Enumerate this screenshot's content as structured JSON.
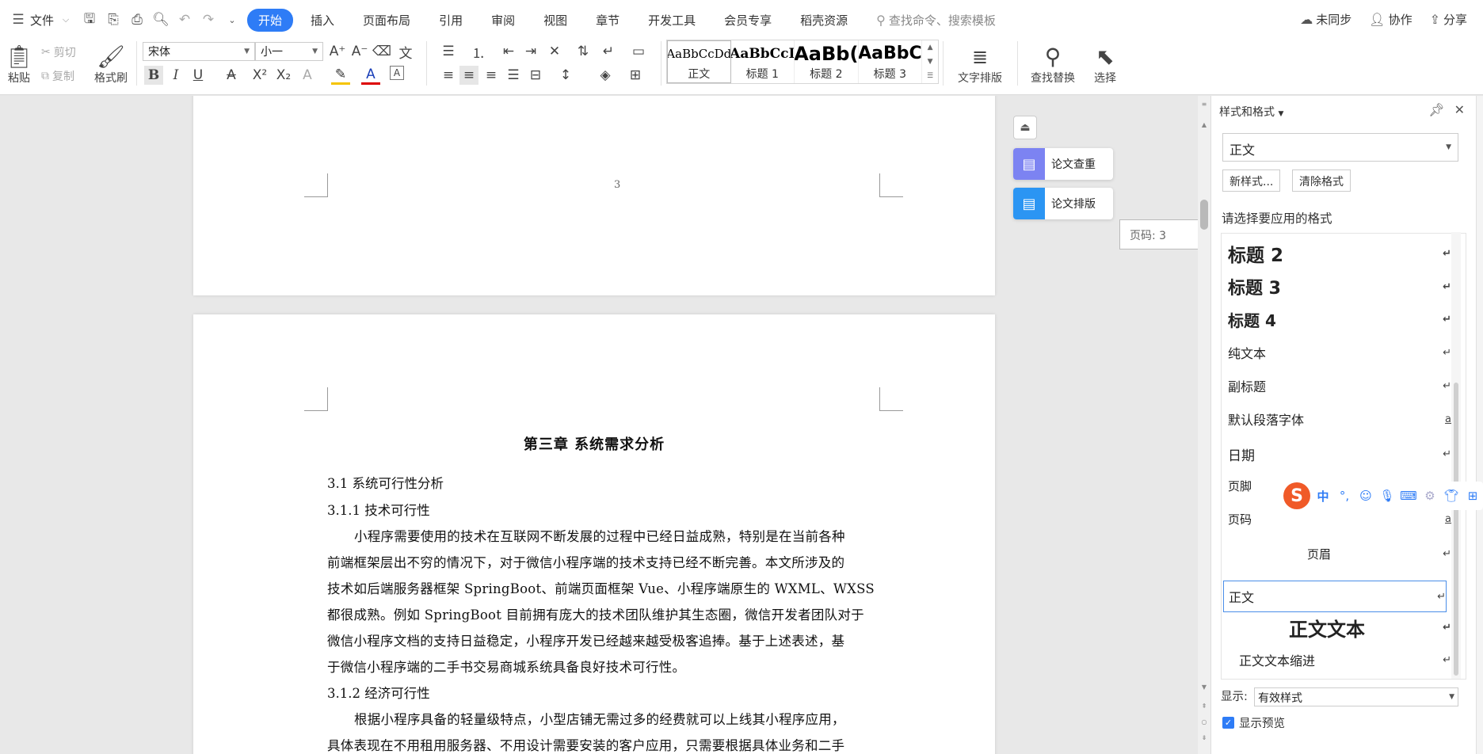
{
  "topbar": {
    "menu_label": "文件",
    "tabs": [
      "开始",
      "插入",
      "页面布局",
      "引用",
      "审阅",
      "视图",
      "章节",
      "开发工具",
      "会员专享",
      "稻壳资源"
    ],
    "active_tab_index": 0,
    "search_placeholder": "查找命令、搜索模板",
    "actions": {
      "sync": "未同步",
      "collab": "协作",
      "share": "分享"
    }
  },
  "ribbon": {
    "paste": "粘贴",
    "cut": "剪切",
    "copy": "复制",
    "format_painter": "格式刷",
    "font_name": "宋体",
    "font_size": "小一",
    "styles": [
      {
        "preview": "AaBbCcDd",
        "label": "正文"
      },
      {
        "preview": "AaBbCcI",
        "label": "标题 1"
      },
      {
        "preview": "AaBb(",
        "label": "标题 2"
      },
      {
        "preview": "AaBbC",
        "label": "标题 3"
      }
    ],
    "text_layout": "文字排版",
    "find_replace": "查找替换",
    "select": "选择"
  },
  "document": {
    "page_number": "3",
    "chapter_title": "第三章  系统需求分析",
    "heading_1": "3.1 系统可行性分析",
    "heading_2": "3.1.1  技术可行性",
    "paragraph_lines": [
      "小程序需要使用的技术在互联网不断发展的过程中已经日益成熟，特别是在当前各种",
      "前端框架层出不穷的情况下，对于微信小程序端的技术支持已经不断完善。本文所涉及的",
      "技术如后端服务器框架 SpringBoot、前端页面框架 Vue、小程序端原生的 WXML、WXSS",
      "都很成熟。例如 SpringBoot 目前拥有庞大的技术团队维护其生态圈，微信开发者团队对于",
      "微信小程序文档的支持日益稳定，小程序开发已经越来越受极客追捧。基于上述表述，基",
      "于微信小程序端的二手书交易商城系统具备良好技术可行性。"
    ],
    "heading_3": "3.1.2  经济可行性",
    "paragraph2_line": "根据小程序具备的轻量级特点，小型店铺无需过多的经费就可以上线其小程序应用，",
    "paragraph2_line2": "具体表现在不用租用服务器、不用设计需要安装的客户应用，只需要根据具体业务和二手"
  },
  "float_tools": {
    "check": "论文查重",
    "layout": "论文排版",
    "tooltip": "页码: 3"
  },
  "style_panel": {
    "title": "样式和格式",
    "current_style": "正文",
    "new_style": "新样式...",
    "clear_format": "清除格式",
    "apply_label": "请选择要应用的格式",
    "items": [
      {
        "name": "标题  2",
        "mark": "↵"
      },
      {
        "name": "标题  3",
        "mark": "↵"
      },
      {
        "name": "标题  4",
        "mark": "↵"
      },
      {
        "name": "纯文本",
        "mark": "↵"
      },
      {
        "name": "副标题",
        "mark": "↵"
      },
      {
        "name": "默认段落字体",
        "mark": "a"
      },
      {
        "name": "日期",
        "mark": "↵"
      },
      {
        "name": "页脚",
        "mark": "↵"
      },
      {
        "name": "页码",
        "mark": "a"
      },
      {
        "name": "页眉",
        "mark": "↵"
      },
      {
        "name": "正文",
        "mark": "↵"
      },
      {
        "name": "正文文本",
        "mark": "↵"
      },
      {
        "name": "正文文本缩进",
        "mark": "↵"
      }
    ],
    "show_label": "显示:",
    "show_value": "有效样式",
    "preview_label": "显示预览"
  },
  "ime": {
    "logo": "S",
    "mode": "中",
    "punct": "°,"
  }
}
